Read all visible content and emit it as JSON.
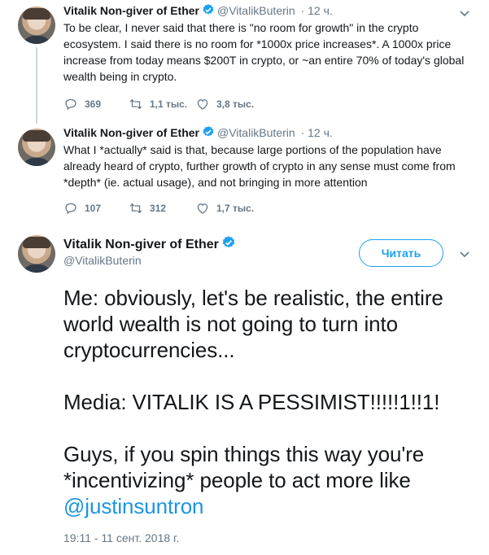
{
  "tweets": [
    {
      "author": {
        "name": "Vitalik Non-giver of Ether",
        "handle": "@VitalikButerin",
        "time": "· 12 ч."
      },
      "text": "To be clear, I never said that there is \"no room for growth\" in the crypto ecosystem. I said there is no room for *1000x price increases*. A 1000x price increase from today means $200T in crypto, or ~an entire 70% of today's global wealth being in crypto.",
      "replies": "369",
      "retweets": "1,1 тыс.",
      "likes": "3,8 тыс."
    },
    {
      "author": {
        "name": "Vitalik Non-giver of Ether",
        "handle": "@VitalikButerin",
        "time": "· 12 ч."
      },
      "text": "What I *actually* said is that, because large portions of the population have already heard of crypto, further growth of crypto in any sense must come from *depth* (ie. actual usage), and not bringing in more attention",
      "replies": "107",
      "retweets": "312",
      "likes": "1,7 тыс."
    }
  ],
  "main_tweet": {
    "author": {
      "name": "Vitalik Non-giver of Ether",
      "handle": "@VitalikButerin"
    },
    "follow_label": "Читать",
    "paragraph1": "Me: obviously, let's be realistic, the entire world wealth is not going to turn into cryptocurrencies...",
    "paragraph2": "Media: VITALIK IS A PESSIMIST!!!!!1!!1!",
    "paragraph3": "Guys, if you spin things this way you're *incentivizing* people to act more like",
    "mention": "@justinsuntron",
    "timestamp": "19:11 - 11 сент. 2018 г."
  },
  "icons": {
    "reply": "reply-icon",
    "retweet": "retweet-icon",
    "like": "heart-icon",
    "verified": "verified-badge-icon",
    "caret": "chevron-down-icon"
  },
  "colors": {
    "accent": "#1da1f2",
    "secondary_text": "#657786",
    "mention": "#1b95e0",
    "verified": "#1da1f2"
  }
}
